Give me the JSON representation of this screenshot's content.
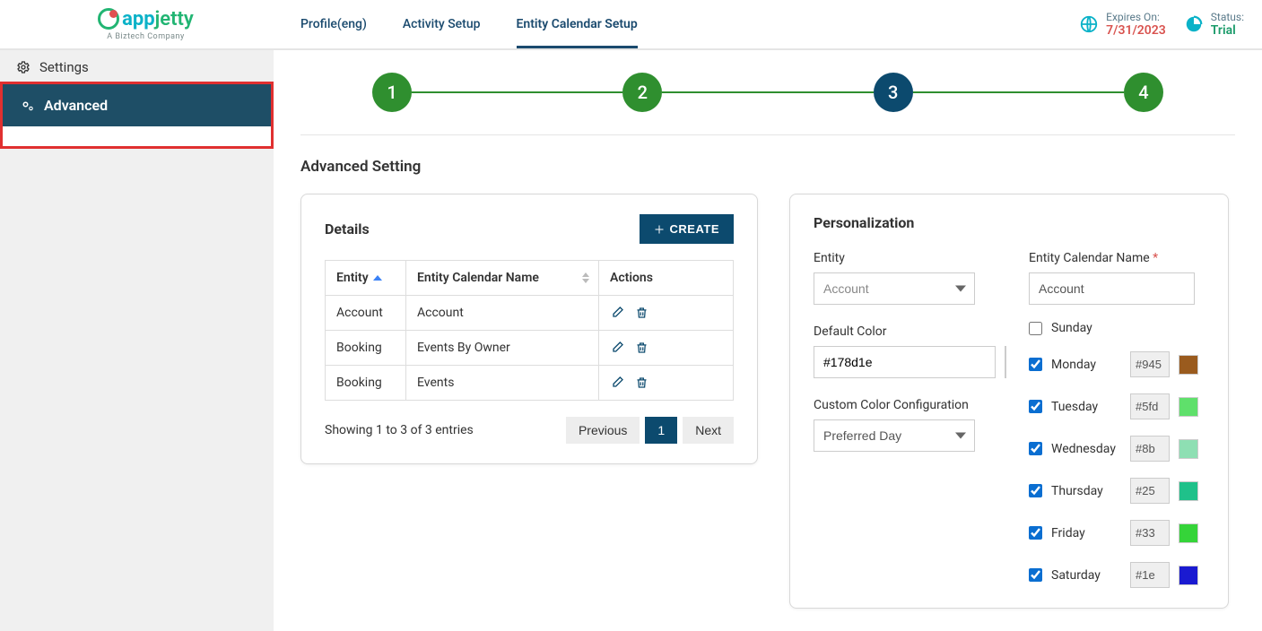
{
  "brand": {
    "name": "appjetty",
    "tagline": "A Biztech Company"
  },
  "tabs": {
    "profile": "Profile(eng)",
    "activity": "Activity Setup",
    "entity": "Entity Calendar Setup"
  },
  "header": {
    "expires_label": "Expires On:",
    "expires_value": "7/31/2023",
    "status_label": "Status:",
    "status_value": "Trial"
  },
  "sidebar": {
    "settings": "Settings",
    "advanced": "Advanced"
  },
  "stepper": [
    "1",
    "2",
    "3",
    "4"
  ],
  "section_title": "Advanced Setting",
  "details": {
    "title": "Details",
    "create": "CREATE",
    "cols": {
      "entity": "Entity",
      "name": "Entity Calendar Name",
      "actions": "Actions"
    },
    "rows": [
      {
        "entity": "Account",
        "name": "Account"
      },
      {
        "entity": "Booking",
        "name": "Events By Owner"
      },
      {
        "entity": "Booking",
        "name": "Events"
      }
    ],
    "showing": "Showing 1 to 3 of 3 entries",
    "prev": "Previous",
    "page": "1",
    "next": "Next"
  },
  "personalization": {
    "title": "Personalization",
    "entity_label": "Entity",
    "entity_value": "Account",
    "name_label": "Entity Calendar Name",
    "name_value": "Account",
    "default_color_label": "Default Color",
    "default_color_value": "#178d1e",
    "default_color_swatch": "#178d1e",
    "custom_label": "Custom Color Configuration",
    "custom_value": "Preferred Day",
    "days": [
      {
        "label": "Sunday",
        "checked": false,
        "code": "",
        "swatch": ""
      },
      {
        "label": "Monday",
        "checked": true,
        "code": "#945",
        "swatch": "#9a5b1e"
      },
      {
        "label": "Tuesday",
        "checked": true,
        "code": "#5fd",
        "swatch": "#5fe06b"
      },
      {
        "label": "Wednesday",
        "checked": true,
        "code": "#8b",
        "swatch": "#8edfb3"
      },
      {
        "label": "Thursday",
        "checked": true,
        "code": "#25",
        "swatch": "#1fc18a"
      },
      {
        "label": "Friday",
        "checked": true,
        "code": "#33",
        "swatch": "#35d439"
      },
      {
        "label": "Saturday",
        "checked": true,
        "code": "#1e",
        "swatch": "#1a1ad1"
      }
    ]
  }
}
